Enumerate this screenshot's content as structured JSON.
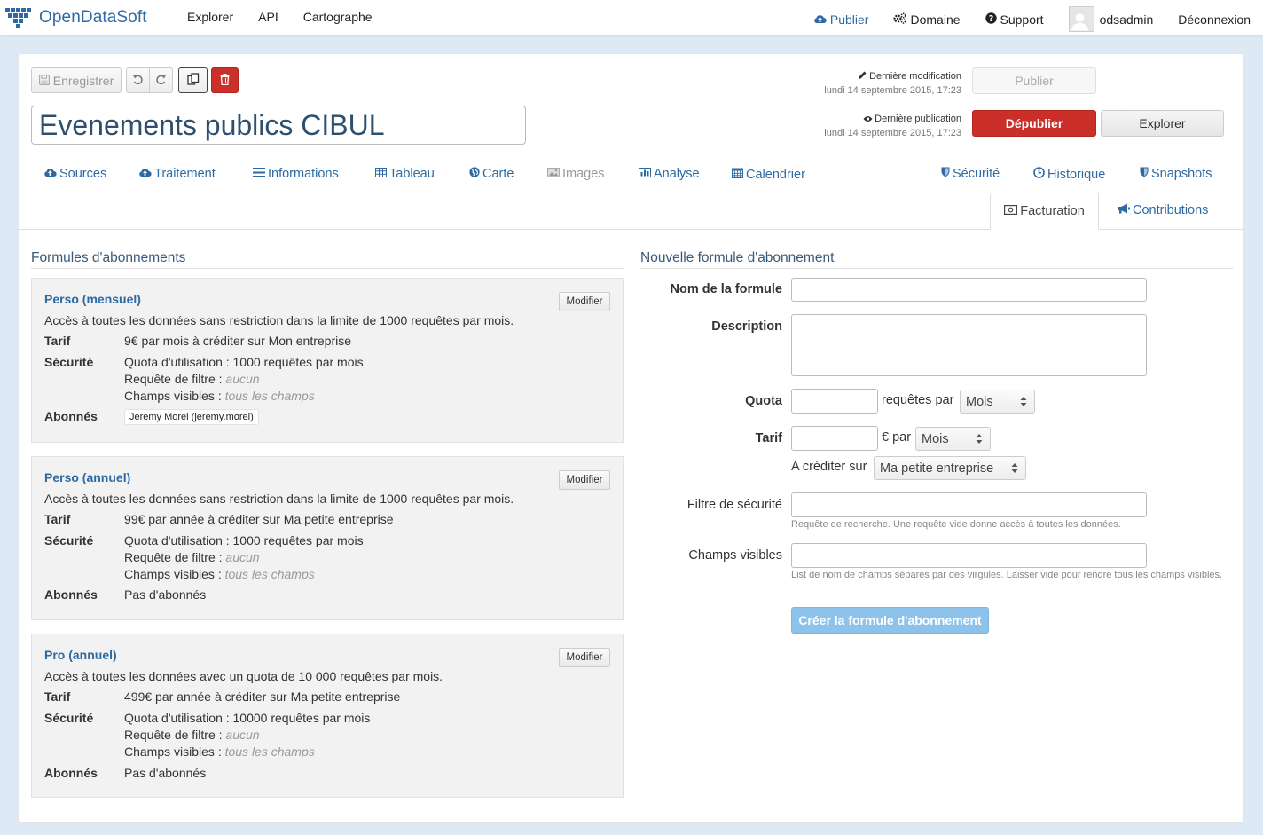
{
  "brand": {
    "name": "OpenDataSoft",
    "logo_icon": "opendatasoft-logo-icon",
    "color": "#2d6aa3"
  },
  "topnav": {
    "left": [
      "Explorer",
      "API",
      "Cartographe"
    ],
    "publier": "Publier",
    "domaine": "Domaine",
    "support": "Support",
    "user": "odsadmin",
    "logout": "Déconnexion"
  },
  "toolbar": {
    "save_label": "Enregistrer",
    "undo_icon": "undo-icon",
    "redo_icon": "redo-icon",
    "copy_icon": "copy-icon",
    "delete_icon": "trash-icon"
  },
  "dataset": {
    "title": "Evenements publics CIBUL"
  },
  "status": {
    "last_modified_label": "Dernière modification",
    "last_modified_date": "lundi 14 septembre 2015, 17:23",
    "last_published_label": "Dernière publication",
    "last_published_date": "lundi 14 septembre 2015, 17:23",
    "publish_button": "Publier",
    "unpublish_button": "Dépublier",
    "explore_button": "Explorer",
    "unpublish_color": "#cb2f2a"
  },
  "tabs": {
    "sources": "Sources",
    "traitement": "Traitement",
    "informations": "Informations",
    "tableau": "Tableau",
    "carte": "Carte",
    "images": "Images",
    "analyse": "Analyse",
    "calendrier": "Calendrier",
    "securite": "Sécurité",
    "historique": "Historique",
    "snapshots": "Snapshots",
    "facturation": "Facturation",
    "contributions": "Contributions",
    "active": "Facturation"
  },
  "plans": {
    "title": "Formules d'abonnements",
    "modify_label": "Modifier",
    "labels": {
      "tarif": "Tarif",
      "securite": "Sécurité",
      "abonnes": "Abonnés"
    },
    "items": [
      {
        "name": "Perso (mensuel)",
        "description": "Accès à toutes les données sans restriction dans la limite de 1000 requêtes par mois.",
        "tarif": "9€ par mois à créditer sur Mon entreprise",
        "quota": "Quota d'utilisation : 1000 requêtes par mois",
        "filtre_label": "Requête de filtre : ",
        "filtre_value": "aucun",
        "champs_label": "Champs visibles : ",
        "champs_value": "tous les champs",
        "abonnes": "Jeremy Morel (jeremy.morel)"
      },
      {
        "name": "Perso (annuel)",
        "description": "Accès à toutes les données sans restriction dans la limite de 1000 requêtes par mois.",
        "tarif": "99€ par année à créditer sur Ma petite entreprise",
        "quota": "Quota d'utilisation : 1000 requêtes par mois",
        "filtre_label": "Requête de filtre : ",
        "filtre_value": "aucun",
        "champs_label": "Champs visibles : ",
        "champs_value": "tous les champs",
        "abonnes": "Pas d'abonnés"
      },
      {
        "name": "Pro (annuel)",
        "description": "Accès à toutes les données avec un quota de 10 000 requêtes par mois.",
        "tarif": "499€ par année à créditer sur Ma petite entreprise",
        "quota": "Quota d'utilisation : 10000 requêtes par mois",
        "filtre_label": "Requête de filtre : ",
        "filtre_value": "aucun",
        "champs_label": "Champs visibles : ",
        "champs_value": "tous les champs",
        "abonnes": "Pas d'abonnés"
      }
    ]
  },
  "form": {
    "title": "Nouvelle formule d'abonnement",
    "name_label": "Nom de la formule",
    "name_value": "",
    "description_label": "Description",
    "description_value": "",
    "quota_label": "Quota",
    "quota_value": "",
    "quota_unit": "requêtes par",
    "quota_period": "Mois",
    "tarif_label": "Tarif",
    "tarif_value": "",
    "tarif_unit": "€ par",
    "tarif_period": "Mois",
    "credit_label": "A créditer sur",
    "credit_value": "Ma petite entreprise",
    "filter_label": "Filtre de sécurité",
    "filter_value": "",
    "filter_help": "Requête de recherche. Une requête vide donne accès à toutes les données.",
    "fields_label": "Champs visibles",
    "fields_value": "",
    "fields_help": "List de nom de champs séparés par des virgules. Laisser vide pour rendre tous les champs visibles.",
    "submit_label": "Créer la formule d'abonnement"
  }
}
